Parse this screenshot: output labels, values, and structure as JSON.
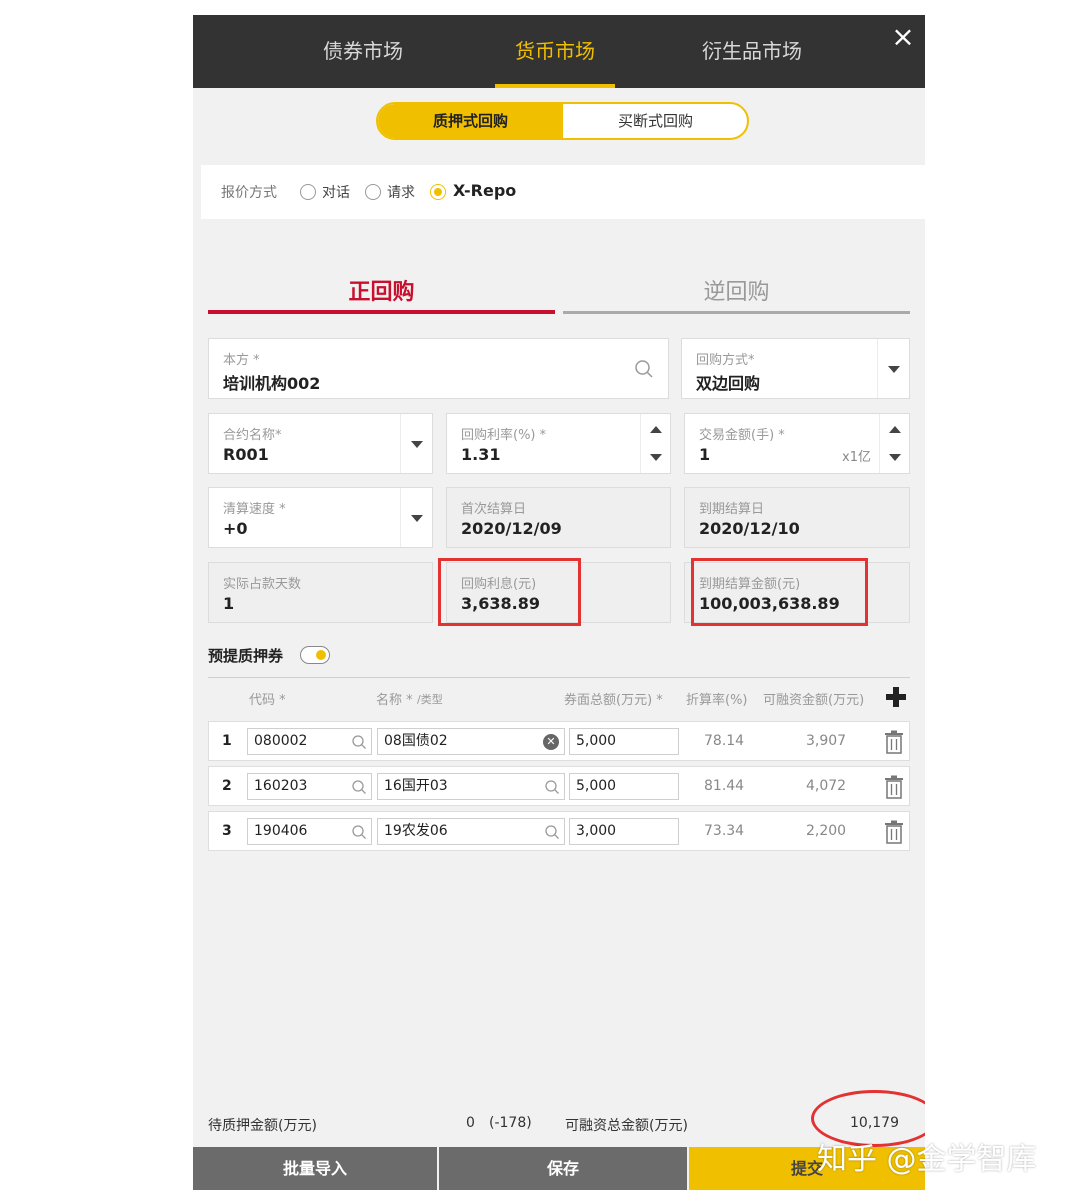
{
  "colors": {
    "accent": "#f0c000",
    "primary_red": "#c8102e",
    "topbar": "#333333",
    "highlight": "#e23232"
  },
  "market_tabs": [
    "债券市场",
    "货币市场",
    "衍生品市场"
  ],
  "close_symbol": "×",
  "repo_type": {
    "active": "质押式回购",
    "inactive": "买断式回购"
  },
  "quote_mode": {
    "label": "报价方式",
    "options": [
      "对话",
      "请求",
      "X-Repo"
    ],
    "selected": "X-Repo"
  },
  "direction": {
    "active": "正回购",
    "inactive": "逆回购"
  },
  "form": {
    "party_label": "本方 *",
    "party_value": "培训机构002",
    "repo_method_label": "回购方式*",
    "repo_method_value": "双边回购",
    "contract_label": "合约名称*",
    "contract_value": "R001",
    "rate_label": "回购利率(%) *",
    "rate_value": "1.31",
    "amount_label": "交易金额(手) *",
    "amount_value": "1",
    "amount_unit": "x1亿",
    "speed_label": "清算速度 *",
    "speed_value": "+0",
    "first_date_label": "首次结算日",
    "first_date_value": "2020/12/09",
    "maturity_date_label": "到期结算日",
    "maturity_date_value": "2020/12/10",
    "days_label": "实际占款天数",
    "days_value": "1",
    "interest_label": "回购利息(元)",
    "interest_value": "3,638.89",
    "maturity_amount_label": "到期结算金额(元)",
    "maturity_amount_value": "100,003,638.89"
  },
  "collateral": {
    "title": "预提质押券",
    "toggle_on": true,
    "headers": {
      "code": "代码 *",
      "name": "名称 *",
      "type": "/类型",
      "face": "券面总额(万元) *",
      "haircut": "折算率(%)",
      "financing": "可融资金额(万元)"
    },
    "rows": [
      {
        "idx": "1",
        "code": "080002",
        "name": "08国债02",
        "face": "5,000",
        "haircut": "78.14",
        "financing": "3,907"
      },
      {
        "idx": "2",
        "code": "160203",
        "name": "16国开03",
        "face": "5,000",
        "haircut": "81.44",
        "financing": "4,072"
      },
      {
        "idx": "3",
        "code": "190406",
        "name": "19农发06",
        "face": "3,000",
        "haircut": "73.34",
        "financing": "2,200"
      }
    ]
  },
  "footer": {
    "pending_label": "待质押金额(万元)",
    "pending_value": "0",
    "pending_delta": "(-178)",
    "total_label": "可融资总金额(万元)",
    "total_value": "10,179",
    "buttons": {
      "import": "批量导入",
      "save": "保存",
      "submit": "提交"
    }
  },
  "watermark": "知乎 @金学智库"
}
